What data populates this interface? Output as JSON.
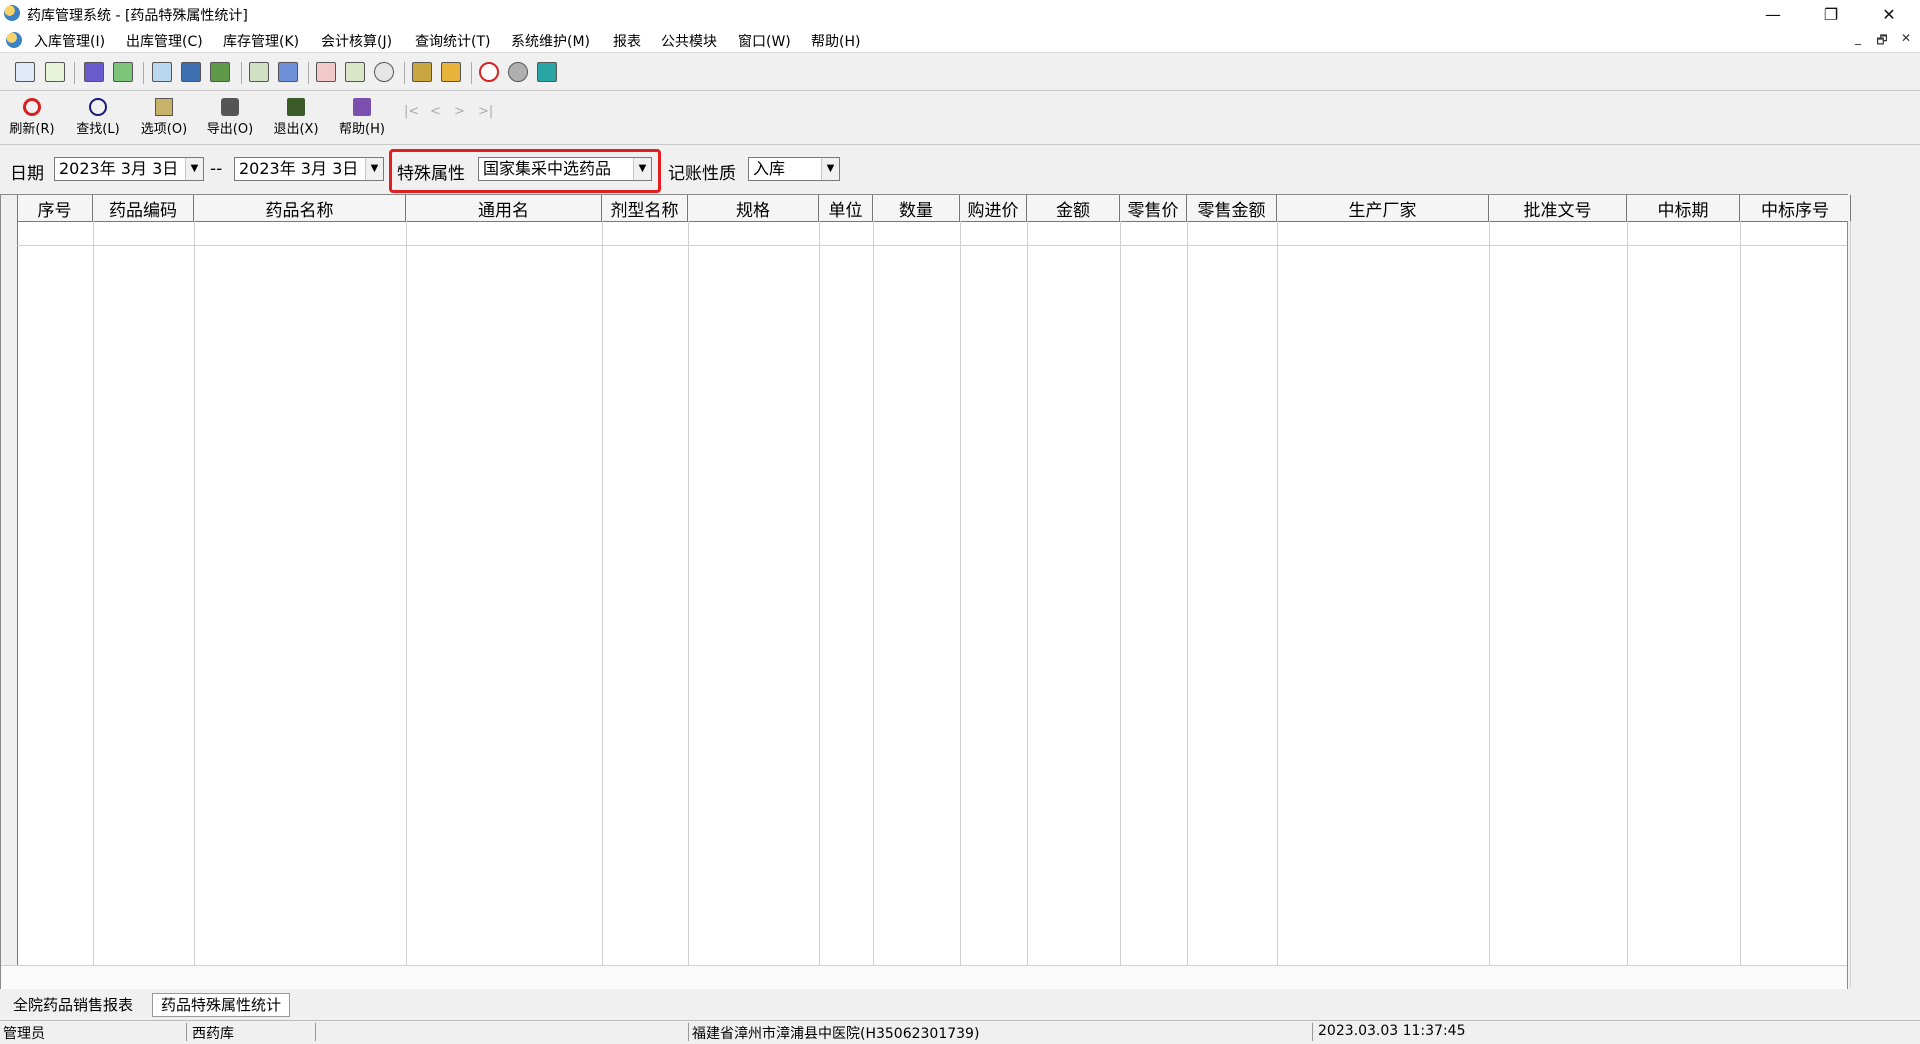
{
  "window": {
    "title": "药库管理系统 - [药品特殊属性统计]",
    "minimize": "—",
    "restore": "❐",
    "close": "✕"
  },
  "menu": {
    "items": [
      "入库管理(I)",
      "出库管理(C)",
      "库存管理(K)",
      "会计核算(J)",
      "查询统计(T)",
      "系统维护(M)",
      "报表",
      "公共模块",
      "窗口(W)",
      "帮助(H)"
    ],
    "mdi_controls": [
      "_",
      "🗗",
      "✕"
    ]
  },
  "toolbar": {
    "buttons": [
      {
        "label": "刷新(R)",
        "icon": "refresh-icon"
      },
      {
        "label": "查找(L)",
        "icon": "search-icon"
      },
      {
        "label": "选项(O)",
        "icon": "options-icon"
      },
      {
        "label": "导出(O)",
        "icon": "printer-icon"
      },
      {
        "label": "退出(X)",
        "icon": "exit-door-icon"
      },
      {
        "label": "帮助(H)",
        "icon": "help-book-icon"
      }
    ],
    "nav": [
      "|<",
      "<",
      ">",
      ">|"
    ]
  },
  "filter": {
    "date_label": "日期",
    "date_from": "2023年  3月  3日",
    "date_separator": "--",
    "date_to": "2023年  3月  3日",
    "special_attr_label": "特殊属性",
    "special_attr_value": "国家集采中选药品",
    "account_type_label": "记账性质",
    "account_type_value": "入库"
  },
  "table": {
    "columns": [
      "序号",
      "药品编码",
      "药品名称",
      "通用名",
      "剂型名称",
      "规格",
      "单位",
      "数量",
      "购进价",
      "金额",
      "零售价",
      "零售金额",
      "生产厂家",
      "批准文号",
      "中标期",
      "中标序号"
    ]
  },
  "tabs": [
    "全院药品销售报表",
    "药品特殊属性统计"
  ],
  "active_tab": 1,
  "status": {
    "user": "管理员",
    "pharmacy": "西药库",
    "hospital": "福建省漳州市漳浦县中医院(H35062301739)",
    "datetime": "2023.03.03 11:37:45"
  }
}
